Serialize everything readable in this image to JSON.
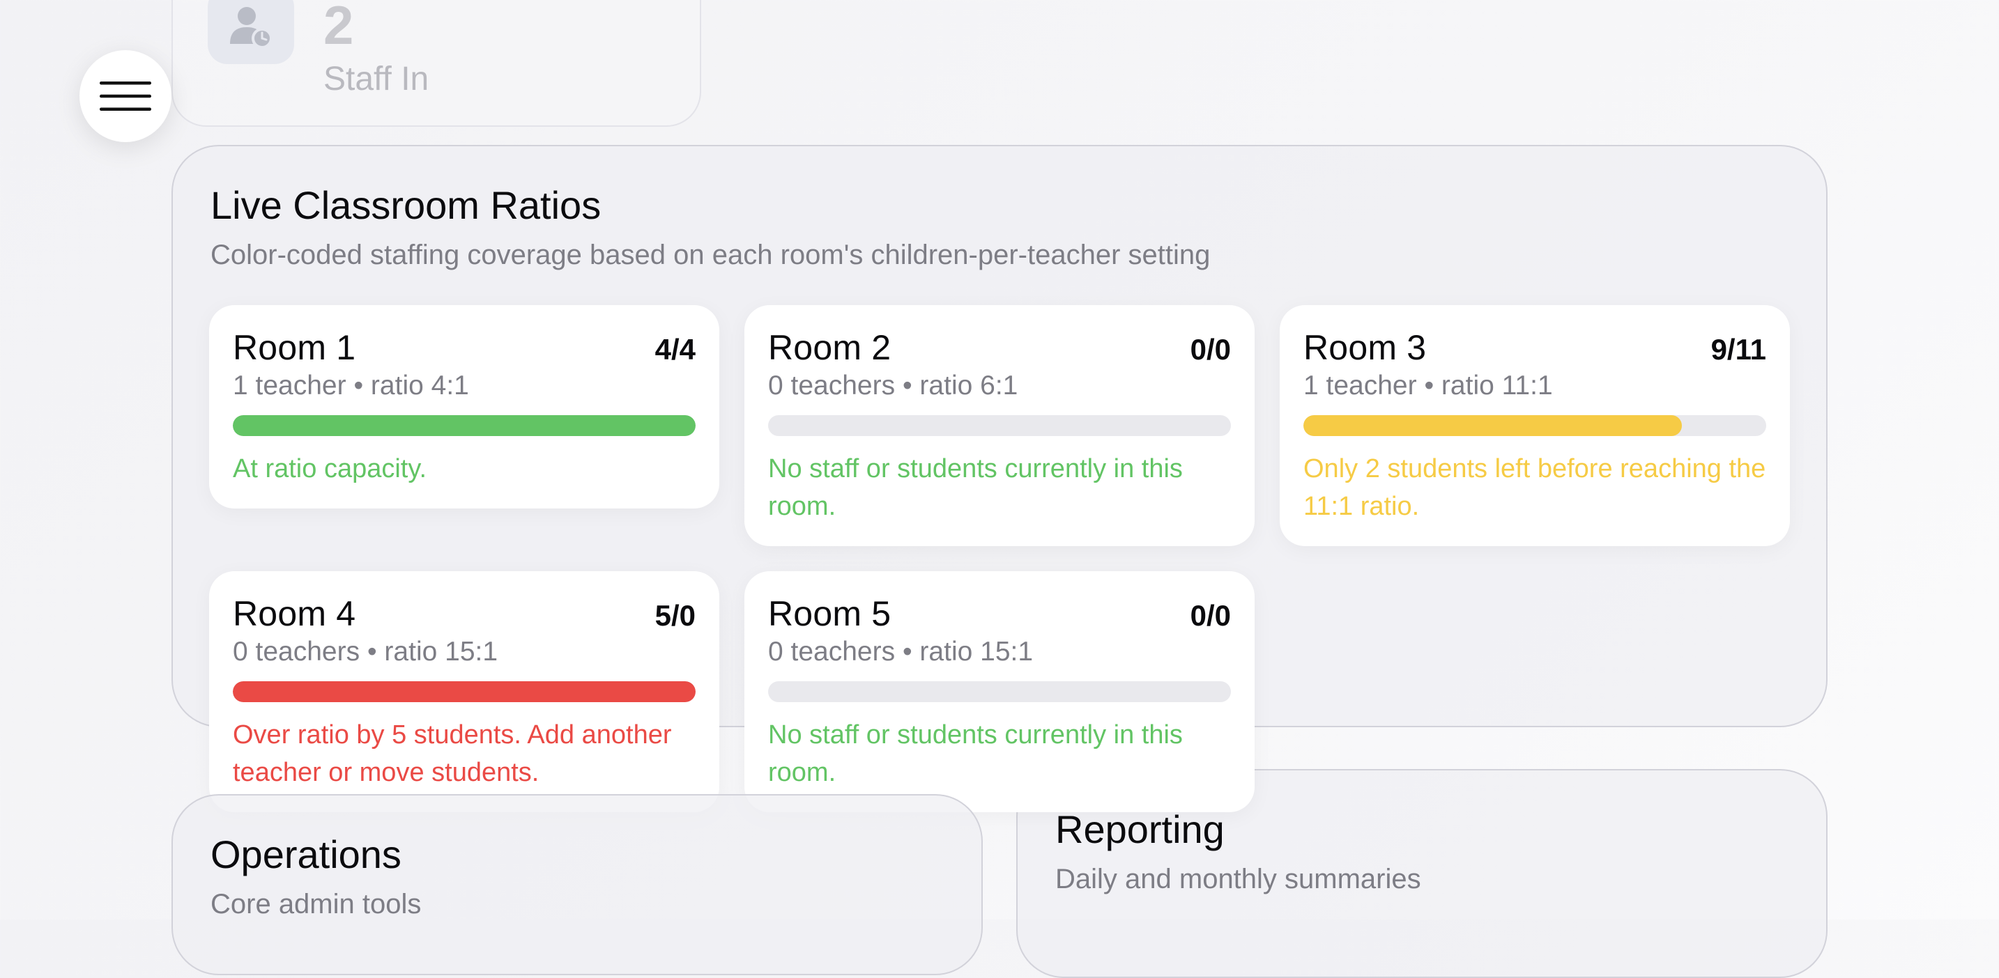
{
  "staff_card": {
    "value": "2",
    "label": "Staff In",
    "icon": "person-clock-icon"
  },
  "menu": {
    "icon": "hamburger-menu-icon"
  },
  "ratios": {
    "title": "Live Classroom Ratios",
    "subtitle": "Color-coded staffing coverage based on each room's children-per-teacher setting",
    "rooms": [
      {
        "name": "Room 1",
        "count": "4/4",
        "sub": "1 teacher • ratio 4:1",
        "fill": 1.0,
        "color": "#62c464",
        "message": "At ratio capacity."
      },
      {
        "name": "Room 2",
        "count": "0/0",
        "sub": "0 teachers • ratio 6:1",
        "fill": 0,
        "color": "#62c464",
        "message": "No staff or students currently in this room."
      },
      {
        "name": "Room 3",
        "count": "9/11",
        "sub": "1 teacher • ratio 11:1",
        "fill": 0.818,
        "color": "#f6cb45",
        "message": "Only 2 students left before reaching the 11:1 ratio."
      },
      {
        "name": "Room 4",
        "count": "5/0",
        "sub": "0 teachers • ratio 15:1",
        "fill": 1.0,
        "color": "#ea4a45",
        "message": "Over ratio by 5 students. Add another teacher or move students."
      },
      {
        "name": "Room 5",
        "count": "0/0",
        "sub": "0 teachers • ratio 15:1",
        "fill": 0,
        "color": "#62c464",
        "message": "No staff or students currently in this room."
      }
    ]
  },
  "operations": {
    "title": "Operations",
    "subtitle": "Core admin tools"
  },
  "reporting": {
    "title": "Reporting",
    "subtitle": "Daily and monthly summaries"
  }
}
